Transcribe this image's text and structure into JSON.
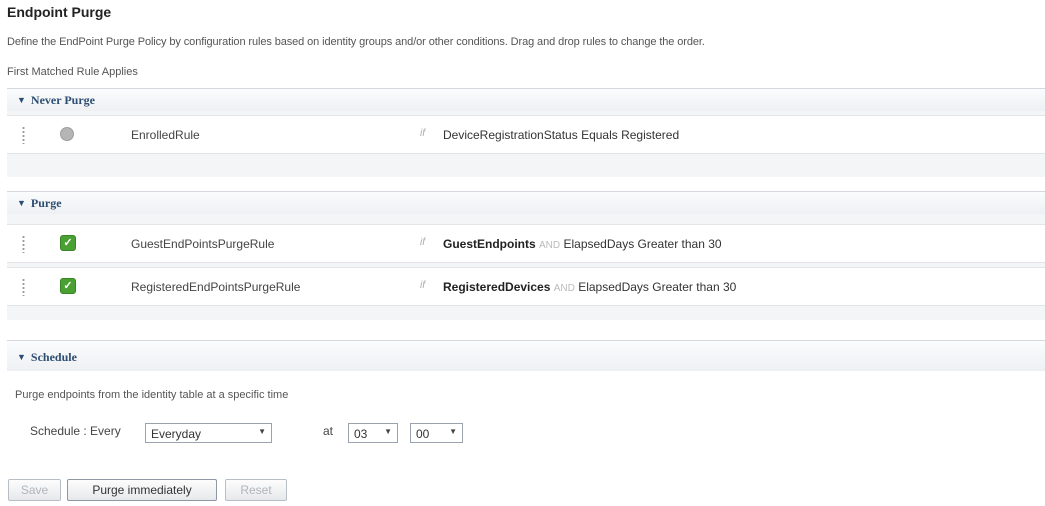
{
  "page": {
    "title": "Endpoint Purge",
    "description": "Define the EndPoint Purge Policy by configuration rules based on identity groups and/or other conditions. Drag and drop rules to change the order.",
    "first_matched": "First Matched Rule Applies"
  },
  "never_purge": {
    "title": "Never Purge",
    "rules": [
      {
        "name": "EnrolledRule",
        "if": "if",
        "condition": "DeviceRegistrationStatus Equals Registered"
      }
    ]
  },
  "purge": {
    "title": "Purge",
    "rules": [
      {
        "name": "GuestEndPointsPurgeRule",
        "if": "if",
        "group": "GuestEndpoints",
        "and": "AND",
        "condition": "ElapsedDays Greater than 30"
      },
      {
        "name": "RegisteredEndPointsPurgeRule",
        "if": "if",
        "group": "RegisteredDevices",
        "and": "AND",
        "condition": "ElapsedDays Greater than 30"
      }
    ]
  },
  "schedule": {
    "title": "Schedule",
    "text": "Purge endpoints from the identity table at a specific time",
    "label": "Schedule : Every",
    "frequency": "Everyday",
    "at": "at",
    "hour": "03",
    "minute": "00"
  },
  "buttons": {
    "save": "Save",
    "purge": "Purge immediately",
    "reset": "Reset"
  }
}
